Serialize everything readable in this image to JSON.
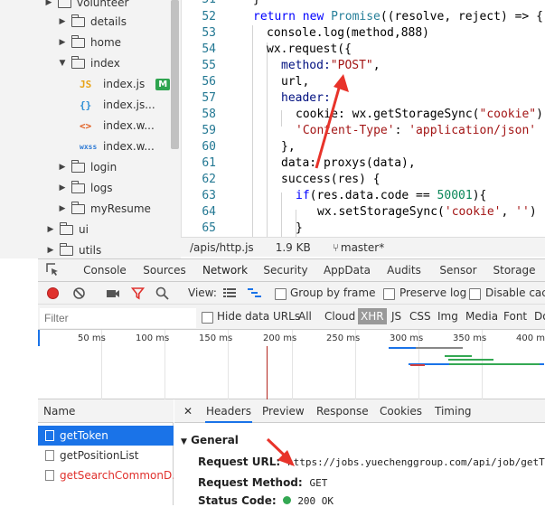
{
  "file_tree": {
    "items": [
      {
        "label": "volunteer",
        "type": "folder",
        "expanded": false
      },
      {
        "label": "details",
        "type": "folder",
        "expanded": false
      },
      {
        "label": "home",
        "type": "folder",
        "expanded": false
      },
      {
        "label": "index",
        "type": "folder",
        "expanded": true
      },
      {
        "label": "index.js",
        "type": "js",
        "badge": "M"
      },
      {
        "label": "index.js...",
        "type": "json"
      },
      {
        "label": "index.w...",
        "type": "wxml"
      },
      {
        "label": "index.w...",
        "type": "wxss"
      },
      {
        "label": "login",
        "type": "folder",
        "expanded": false
      },
      {
        "label": "logs",
        "type": "folder",
        "expanded": false
      },
      {
        "label": "myResume",
        "type": "folder",
        "expanded": false
      },
      {
        "label": "ui",
        "type": "folder",
        "expanded": false
      },
      {
        "label": "utils",
        "type": "folder",
        "expanded": false
      }
    ]
  },
  "editor": {
    "line_numbers": [
      "51",
      "52",
      "53",
      "54",
      "55",
      "56",
      "57",
      "58",
      "59",
      "60",
      "61",
      "62",
      "63",
      "64",
      "65"
    ],
    "code": {
      "l51": "}",
      "l52_kw": "return new ",
      "l52_cls": "Promise",
      "l52_rest": "((resolve, reject) => {",
      "l53": "console.log(method,888)",
      "l54": "wx.request({",
      "l55_a": "method:",
      "l55_b": "\"POST\"",
      "l55_c": ",",
      "l56": "url,",
      "l57": "header:",
      "l58_a": "cookie: wx.getStorageSync(",
      "l58_b": "\"cookie\"",
      "l58_c": "),",
      "l59_a": "'Content-Type'",
      "l59_b": ": ",
      "l59_c": "'application/json'",
      "l60": "},",
      "l61": "data: proxys(data),",
      "l62": "success(res) {",
      "l63_a": "if",
      "l63_b": "(res.data.code == ",
      "l63_c": "50001",
      "l63_d": "){",
      "l64_a": "wx.setStorageSync(",
      "l64_b": "'cookie'",
      "l64_c": ", ",
      "l64_d": "''",
      "l64_e": ")",
      "l65": "}"
    }
  },
  "status_bar": {
    "path": "/apis/http.js",
    "size": "1.9 KB",
    "branch": "master*"
  },
  "devtools": {
    "tabs": [
      "Console",
      "Sources",
      "Network",
      "Security",
      "AppData",
      "Audits",
      "Sensor",
      "Storage"
    ],
    "active_tab": "Network",
    "toolbar": {
      "view_label": "View:",
      "group_by_frame": "Group by frame",
      "preserve_log": "Preserve log",
      "disable_cache": "Disable cach"
    },
    "filter": {
      "placeholder": "Filter",
      "hide_data_urls": "Hide data URLs",
      "types": [
        "All",
        "Cloud",
        "XHR",
        "JS",
        "CSS",
        "Img",
        "Media",
        "Font",
        "Do"
      ],
      "active_type": "XHR"
    },
    "timeline": {
      "ticks": [
        "50 ms",
        "100 ms",
        "150 ms",
        "200 ms",
        "250 ms",
        "300 ms",
        "350 ms",
        "400 ms"
      ]
    },
    "requests": {
      "header": "Name",
      "rows": [
        {
          "name": "getToken",
          "selected": true,
          "error": false
        },
        {
          "name": "getPositionList",
          "selected": false,
          "error": false
        },
        {
          "name": "getSearchCommonD...",
          "selected": false,
          "error": true
        }
      ]
    },
    "details": {
      "close": "✕",
      "tabs": [
        "Headers",
        "Preview",
        "Response",
        "Cookies",
        "Timing"
      ],
      "active_tab": "Headers",
      "section": "General",
      "request_url_label": "Request URL:",
      "request_url": "https://jobs.yuechenggroup.com/api/job/getToke",
      "request_method_label": "Request Method:",
      "request_method": "GET",
      "status_code_label": "Status Code:",
      "status_code": "200 OK",
      "status_color": "#34a853"
    }
  },
  "colors": {
    "accent": "#1a73e8",
    "annotation_arrow": "#e8332a",
    "error_text": "#e0312d"
  }
}
